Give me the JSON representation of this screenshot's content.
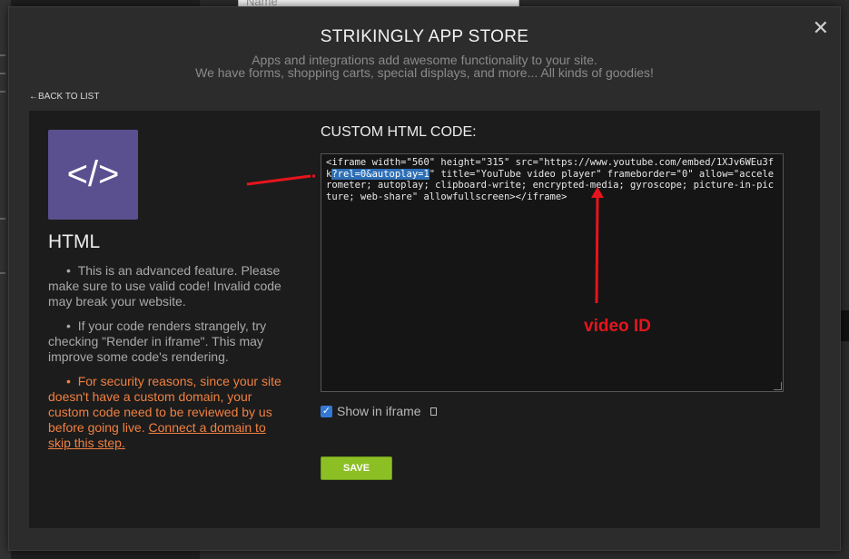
{
  "background": {
    "field_placeholder": "Name"
  },
  "modal": {
    "title": "STRIKINGLY APP STORE",
    "subtitle_line1": "Apps and integrations add awesome functionality to your site.",
    "subtitle_line2": "We have forms, shopping carts, special displays, and more... All kinds of goodies!",
    "close_icon": "close-icon",
    "back_link": "BACK TO LIST",
    "back_icon": "←"
  },
  "app": {
    "icon_glyph": "</>",
    "name": "HTML",
    "notes": [
      "This is an advanced feature. Please make sure to use valid code! Invalid code may break your website.",
      "If your code renders strangely, try checking \"Render in iframe\". This may improve some code's rendering."
    ],
    "warning_text": "For security reasons, since your site doesn't have a custom domain, your custom code need to be reviewed by us before going live. ",
    "warning_link": "Connect a domain to skip this step."
  },
  "editor": {
    "label": "CUSTOM HTML CODE:",
    "code_before": "<iframe width=\"560\" height=\"315\" src=\"https://www.youtube.com/embed/1XJv6WEu3fk",
    "code_selected": "?rel=0&autoplay=1",
    "code_after": "\" title=\"YouTube video player\" frameborder=\"0\" allow=\"accelerometer; autoplay; clipboard-write; encrypted-media; gyroscope; picture-in-picture; web-share\" allowfullscreen></iframe>"
  },
  "annotation": {
    "label": "video ID",
    "color": "#e8141c"
  },
  "options": {
    "show_iframe_label": "Show in iframe",
    "show_iframe_checked": true
  },
  "actions": {
    "save_label": "SAVE"
  },
  "colors": {
    "accent_green": "#8cbf24",
    "icon_purple": "#5a5090",
    "warning_orange": "#f08040",
    "selection_blue": "#2d6fb6"
  }
}
